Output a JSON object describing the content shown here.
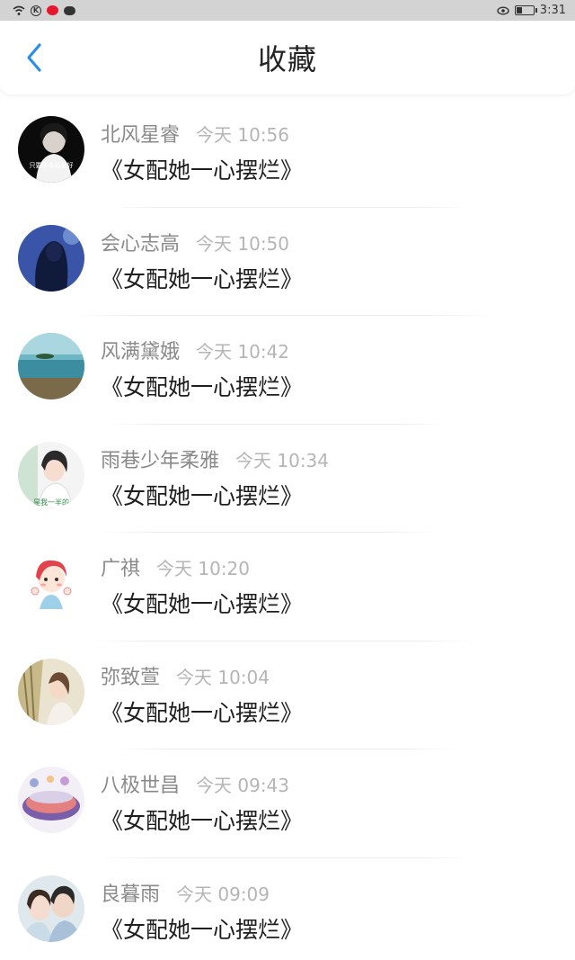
{
  "status_bar": {
    "time": "3:31",
    "icons": [
      "wifi-icon",
      "k-icon",
      "weibo-icon",
      "wechat-icon"
    ],
    "right_icons": [
      "eye-icon",
      "battery-icon"
    ]
  },
  "header": {
    "title": "收藏",
    "back_icon": "chevron-left-icon",
    "accent_color": "#2a8ee6"
  },
  "items": [
    {
      "name": "北风星睿",
      "time": "今天 10:56",
      "book": "《女配她一心摆烂》"
    },
    {
      "name": "会心志高",
      "time": "今天 10:50",
      "book": "《女配她一心摆烂》"
    },
    {
      "name": "风满黛娥",
      "time": "今天 10:42",
      "book": "《女配她一心摆烂》"
    },
    {
      "name": "雨巷少年柔雅",
      "time": "今天 10:34",
      "book": "《女配她一心摆烂》"
    },
    {
      "name": "广祺",
      "time": "今天 10:20",
      "book": "《女配她一心摆烂》"
    },
    {
      "name": "弥致萱",
      "time": "今天 10:04",
      "book": "《女配她一心摆烂》"
    },
    {
      "name": "八极世昌",
      "time": "今天 09:43",
      "book": "《女配她一心摆烂》"
    },
    {
      "name": "良暮雨",
      "time": "今天 09:09",
      "book": "《女配她一心摆烂》"
    }
  ],
  "avatar_texts": {
    "avatar_0": "只要你幸福就好",
    "avatar_3": "是我一半的"
  }
}
